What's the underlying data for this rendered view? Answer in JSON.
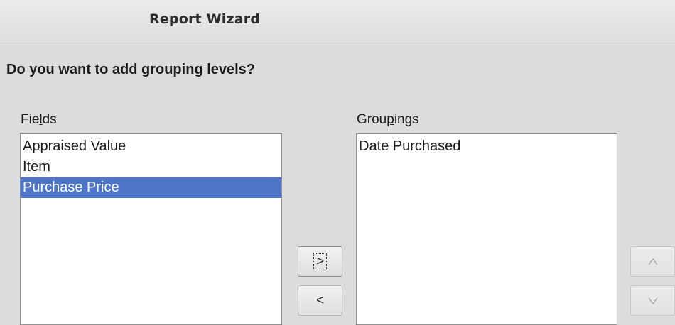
{
  "window": {
    "title": "Report Wizard"
  },
  "page": {
    "question": "Do you want to add grouping levels?"
  },
  "fields": {
    "label_before": "Fie",
    "label_mnemonic": "l",
    "label_after": "ds",
    "items": [
      "Appraised Value",
      "Item",
      "Purchase Price"
    ],
    "selected": "Purchase Price"
  },
  "groupings": {
    "label_before": "Grou",
    "label_mnemonic": "p",
    "label_after": "ings",
    "items": [
      "Date Purchased"
    ]
  },
  "buttons": {
    "add": ">",
    "remove": "<",
    "move_up": "^",
    "move_down": "v"
  },
  "icons": {
    "move_up": "chevron-up-icon",
    "move_down": "chevron-down-icon"
  },
  "colors": {
    "selection": "#4f75c9",
    "background": "#dcdcdc"
  }
}
